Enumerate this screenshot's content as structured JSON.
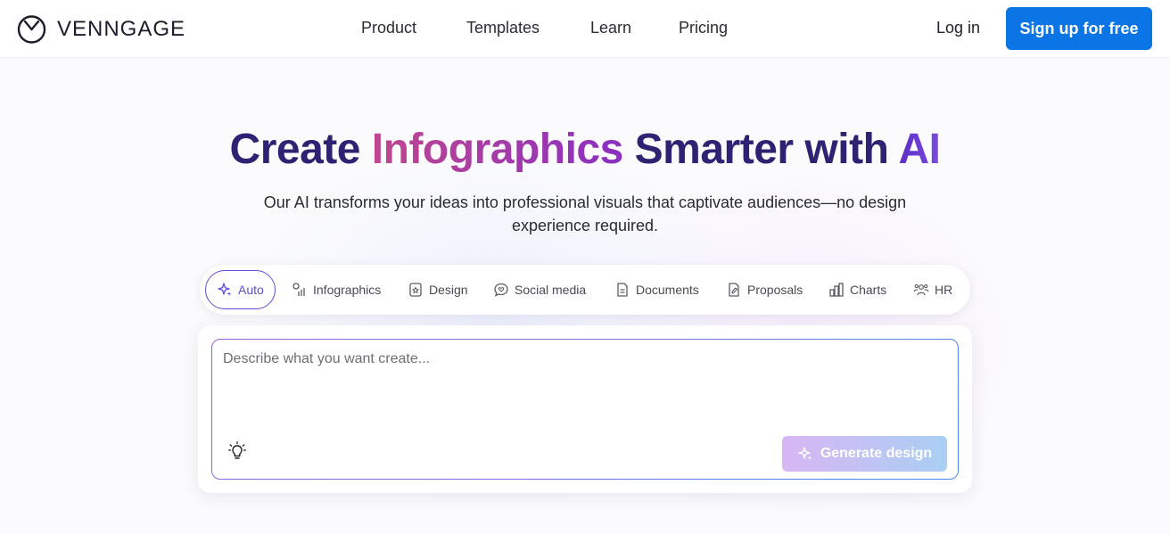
{
  "header": {
    "brand": "VENNGAGE",
    "nav": [
      "Product",
      "Templates",
      "Learn",
      "Pricing"
    ],
    "login": "Log in",
    "signup": "Sign up for free"
  },
  "hero": {
    "title_part1": "Create ",
    "title_part2": "Infographics",
    "title_part3": " Smarter with ",
    "title_part4": "AI",
    "subtitle_line1": "Our AI transforms your ideas into professional visuals that captivate audiences—no design",
    "subtitle_line2": "experience required."
  },
  "tabs": [
    {
      "label": "Auto",
      "icon": "sparkle-icon",
      "active": true
    },
    {
      "label": "Infographics",
      "icon": "infographic-icon"
    },
    {
      "label": "Design",
      "icon": "design-icon"
    },
    {
      "label": "Social media",
      "icon": "chat-heart-icon"
    },
    {
      "label": "Documents",
      "icon": "document-icon"
    },
    {
      "label": "Proposals",
      "icon": "proposal-icon"
    },
    {
      "label": "Charts",
      "icon": "bar-chart-icon"
    },
    {
      "label": "HR",
      "icon": "people-icon"
    }
  ],
  "prompt": {
    "placeholder": "Describe what you want create...",
    "generate": "Generate design"
  },
  "colors": {
    "brand_blue": "#0b75e6",
    "title_navy": "#2e2273",
    "active_tab": "#5a4fd6"
  }
}
